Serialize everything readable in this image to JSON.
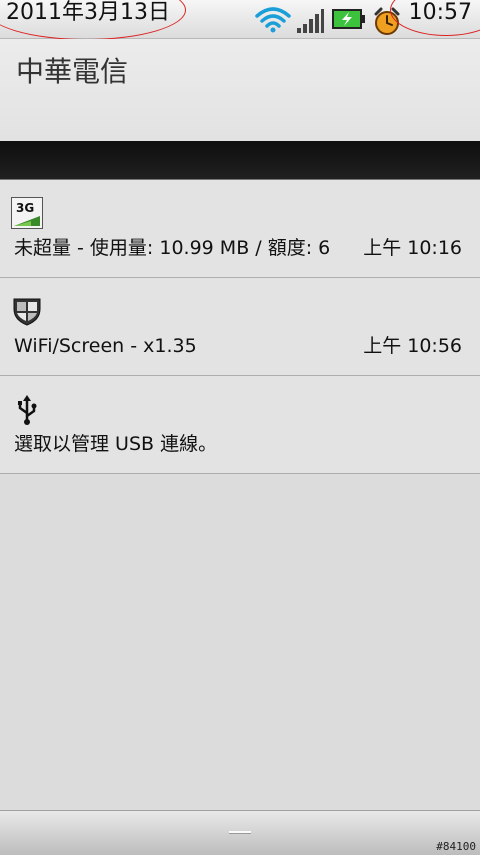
{
  "status_bar": {
    "date": "2011年3月13日",
    "time": "10:57",
    "icons": [
      "wifi-icon",
      "signal-icon",
      "battery-charging-icon",
      "alarm-icon"
    ]
  },
  "carrier": {
    "label": "中華電信"
  },
  "notifications": [
    {
      "icon": "3g-data-icon",
      "icon_text": "3G",
      "text": "未超量 - 使用量: 10.99 MB / 額度: 6",
      "time": "上午 10:16"
    },
    {
      "icon": "shield-icon",
      "text": "WiFi/Screen - x1.35",
      "time": "上午 10:56"
    },
    {
      "icon": "usb-icon",
      "text": "選取以管理 USB 連線。",
      "time": ""
    }
  ],
  "watermark": "#84100",
  "colors": {
    "accent_wifi": "#1a9fd8",
    "battery": "#3cc23c",
    "alarm": "#f0a020",
    "annotation": "#dd2222"
  }
}
